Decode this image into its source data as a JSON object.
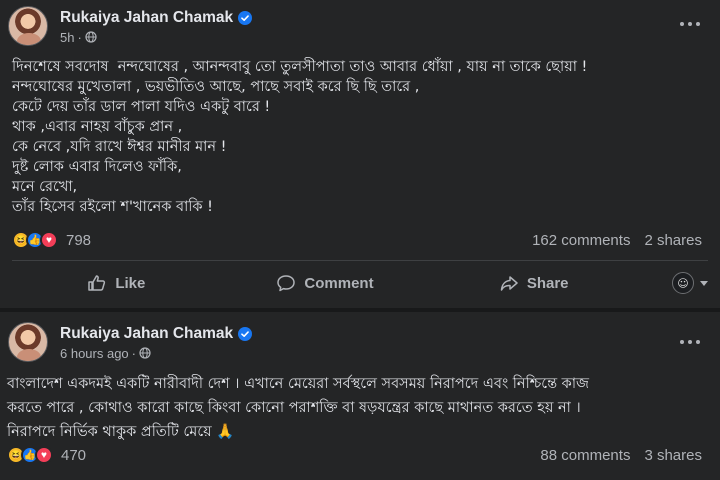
{
  "post1": {
    "author": "Rukaiya Jahan Chamak",
    "time": "5h",
    "text": "দিনশেষে সবদোষ  নন্দঘোষের , আনন্দবাবু তো তুলসীপাতা তাও আবার ধোঁয়া , যায় না তাকে ছোয়া !\nনন্দঘোষের মুখেতালা , ভয়ভীতিও আছে, পাছে সবাই করে ছি ছি তারে ,\nকেটে দেয় তাঁর ডাল পালা যদিও একটু বারে !\nথাক ,এবার নাহয় বাঁচুক প্রান ,\nকে নেবে ,যদি রাখে ঈশ্বর মানীর মান !\nদুষ্ট লোক এবার দিলেও ফাঁকি,\nমনে রেখো,\nতাঁর হিসেব রইলো শ'খানেক বাকি !",
    "reaction_count": "798",
    "comments": "162 comments",
    "shares": "2 shares",
    "actions": {
      "like": "Like",
      "comment": "Comment",
      "share": "Share"
    }
  },
  "post2": {
    "author": "Rukaiya Jahan Chamak",
    "time": "6 hours ago",
    "text": "বাংলাদেশ একদমই একটি নারীবাদী দেশ । এখানে মেয়েরা সর্বস্থলে সবসময় নিরাপদে এবং নিশ্চিন্তে কাজ\nকরতে পারে , কোথাও কারো কাছে কিংবা কোনো পরাশক্তি বা ষড়যন্ত্রের কাছে মাথানত করতে হয় না ।\nনিরাপদে নির্ভিক থাকুক প্রতিটি মেয়ে 🙏",
    "reaction_count": "470",
    "comments": "88 comments",
    "shares": "3 shares"
  },
  "icons": {
    "verified": "verified-badge-icon",
    "globe": "globe-icon",
    "more": "more-options-icon",
    "like": "thumbs-up-icon",
    "comment": "comment-bubble-icon",
    "share": "share-arrow-icon",
    "reactions": [
      "haha-reaction-icon",
      "like-reaction-icon",
      "love-reaction-icon"
    ]
  },
  "colors": {
    "background": "#18191a",
    "card": "#242526",
    "primary_text": "#e4e6eb",
    "secondary_text": "#b0b3b8",
    "accent": "#1877f2"
  }
}
